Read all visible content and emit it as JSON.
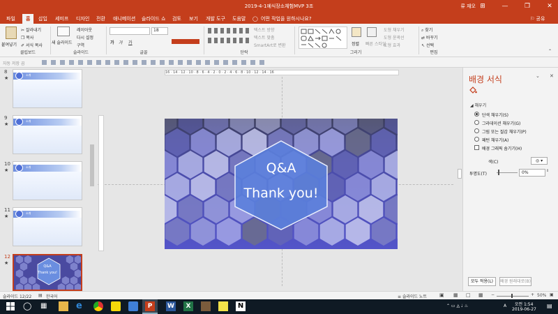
{
  "window": {
    "title": "2019-4-1예식장소체험MVP 3조",
    "user": "류 재오",
    "min": "—",
    "restore": "❐",
    "close": "✕",
    "ribbon_toggle": "⊞"
  },
  "tabs": [
    "파일",
    "홈",
    "삽입",
    "세미프",
    "디자인",
    "전환",
    "애니메이션",
    "슬라이드 쇼",
    "검토",
    "보기",
    "개발 도구",
    "도움말"
  ],
  "active_tab_index": 1,
  "tell_me": "어떤 작업을 원하시나요?",
  "share": "공유",
  "ribbon": {
    "clipboard": {
      "paste": "붙여넣기",
      "cut": "잘라내기",
      "copy": "복사",
      "format_painter": "서식 복사",
      "label": "클립보드"
    },
    "slides": {
      "new_slide": "새 슬라이드",
      "layout": "레이아웃",
      "reset": "다시 설정",
      "section": "구역",
      "label": "슬라이드"
    },
    "font": {
      "size": "18",
      "bold": "가",
      "italic": "가",
      "label": "글꼴"
    },
    "paragraph": {
      "text_direction": "텍스트 방향",
      "align_text": "텍스트 맞춤",
      "smartart": "SmartArt로 변환",
      "label": "단락"
    },
    "drawing": {
      "arrange": "정렬",
      "quick_styles": "빠른 스타일",
      "shape_fill": "도형 채우기",
      "shape_outline": "도형 윤곽선",
      "shape_effects": "도형 효과",
      "label": "그리기"
    },
    "editing": {
      "find": "찾기",
      "replace": "바꾸기",
      "select": "선택",
      "label": "편집"
    }
  },
  "qbar": {
    "autosave": "자동 저장",
    "off": "끔"
  },
  "thumbnails": [
    {
      "num": "8",
      "star": "★",
      "label": "소개"
    },
    {
      "num": "9",
      "star": "★",
      "label": "소개"
    },
    {
      "num": "10",
      "star": "★",
      "label": "소개"
    },
    {
      "num": "11",
      "star": "★",
      "label": "소개"
    },
    {
      "num": "12",
      "star": "★",
      "title": "Q&A",
      "subtitle": "Thank you!"
    }
  ],
  "ruler": {
    "h": "16 · 14 · 12 · 10 · 8 · 6 · 4 · 2 · 0 · 2 · 4 · 6 · 8 · 10 · 12 · 14 · 16"
  },
  "slide": {
    "title": "Q&A",
    "subtitle": "Thank you!"
  },
  "pane": {
    "title": "배경 서식",
    "close": "✕",
    "collapse": "⌄",
    "section": "채우기",
    "options": [
      "단색 채우기(S)",
      "그라데이션 채우기(G)",
      "그림 또는 질감 채우기(P)",
      "패턴 채우기(A)"
    ],
    "hide_graphics": "배경 그래픽 숨기기(H)",
    "color_label": "색(C)",
    "transparency_label": "투명도(T)",
    "transparency_value": "0%",
    "apply_all": "모두 적용(L)",
    "reset": "배경 원래대로(B)"
  },
  "status": {
    "slide": "슬라이드 12/22",
    "lang": "한국어",
    "notes": "슬라이드 노트",
    "zoom": "50%"
  },
  "taskbar": {
    "time": "오전 1:54",
    "date": "2019-06-27",
    "ime": "A"
  },
  "colors": {
    "accent": "#c43e1c",
    "slide_bg": "#4a4ca8",
    "hex_center": "#5b7fdc"
  }
}
